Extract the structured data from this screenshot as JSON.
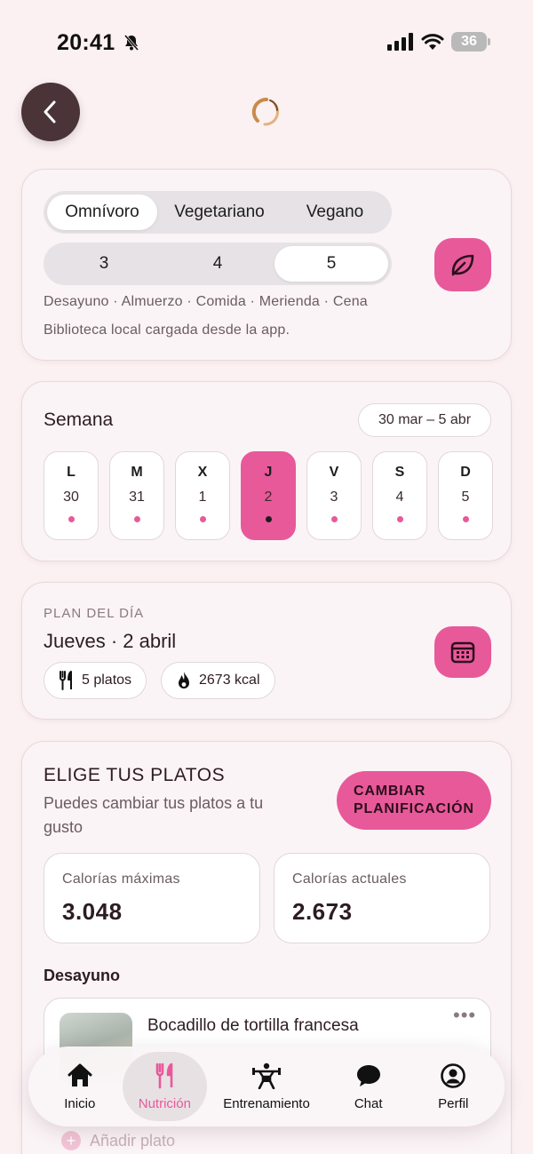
{
  "status_bar": {
    "time": "20:41",
    "battery": "36"
  },
  "diet": {
    "options": [
      "Omnívoro",
      "Vegetariano",
      "Vegano"
    ],
    "meal_counts": [
      "3",
      "4",
      "5"
    ],
    "meals_list": "Desayuno · Almuerzo · Comida · Merienda · Cena",
    "library_note": "Biblioteca local cargada desde la app.",
    "selected_diet": "Omnívoro",
    "selected_meals": "5"
  },
  "week": {
    "title": "Semana",
    "range": "30 mar – 5 abr",
    "days": [
      {
        "letter": "L",
        "num": "30"
      },
      {
        "letter": "M",
        "num": "31"
      },
      {
        "letter": "X",
        "num": "1"
      },
      {
        "letter": "J",
        "num": "2"
      },
      {
        "letter": "V",
        "num": "3"
      },
      {
        "letter": "S",
        "num": "4"
      },
      {
        "letter": "D",
        "num": "5"
      }
    ],
    "selected_day": "J"
  },
  "plan": {
    "eyebrow": "PLAN DEL DÍA",
    "title": "Jueves · 2 abril",
    "plates": "5 platos",
    "kcal": "2673 kcal"
  },
  "choose": {
    "title": "ELIGE TUS PLATOS",
    "subtitle": "Puedes cambiar tus platos a tu gusto",
    "change_button_line1": "CAMBIAR",
    "change_button_line2": "PLANIFICACIÓN",
    "max_label": "Calorías máximas",
    "max_value": "3.048",
    "current_label": "Calorías actuales",
    "current_value": "2.673",
    "section": "Desayuno",
    "dish_name": "Bocadillo de tortilla francesa",
    "add_dish": "Añadir plato"
  },
  "tabbar": {
    "items": [
      {
        "label": "Inicio",
        "icon": "home-icon"
      },
      {
        "label": "Nutrición",
        "icon": "fork-knife-icon"
      },
      {
        "label": "Entrenamiento",
        "icon": "weightlifting-icon"
      },
      {
        "label": "Chat",
        "icon": "chat-bubble-icon"
      },
      {
        "label": "Perfil",
        "icon": "profile-icon"
      }
    ],
    "active": "Nutrición"
  },
  "colors": {
    "accent": "#e8599a",
    "background": "#fbf0f2",
    "dark": "#4a3438"
  }
}
